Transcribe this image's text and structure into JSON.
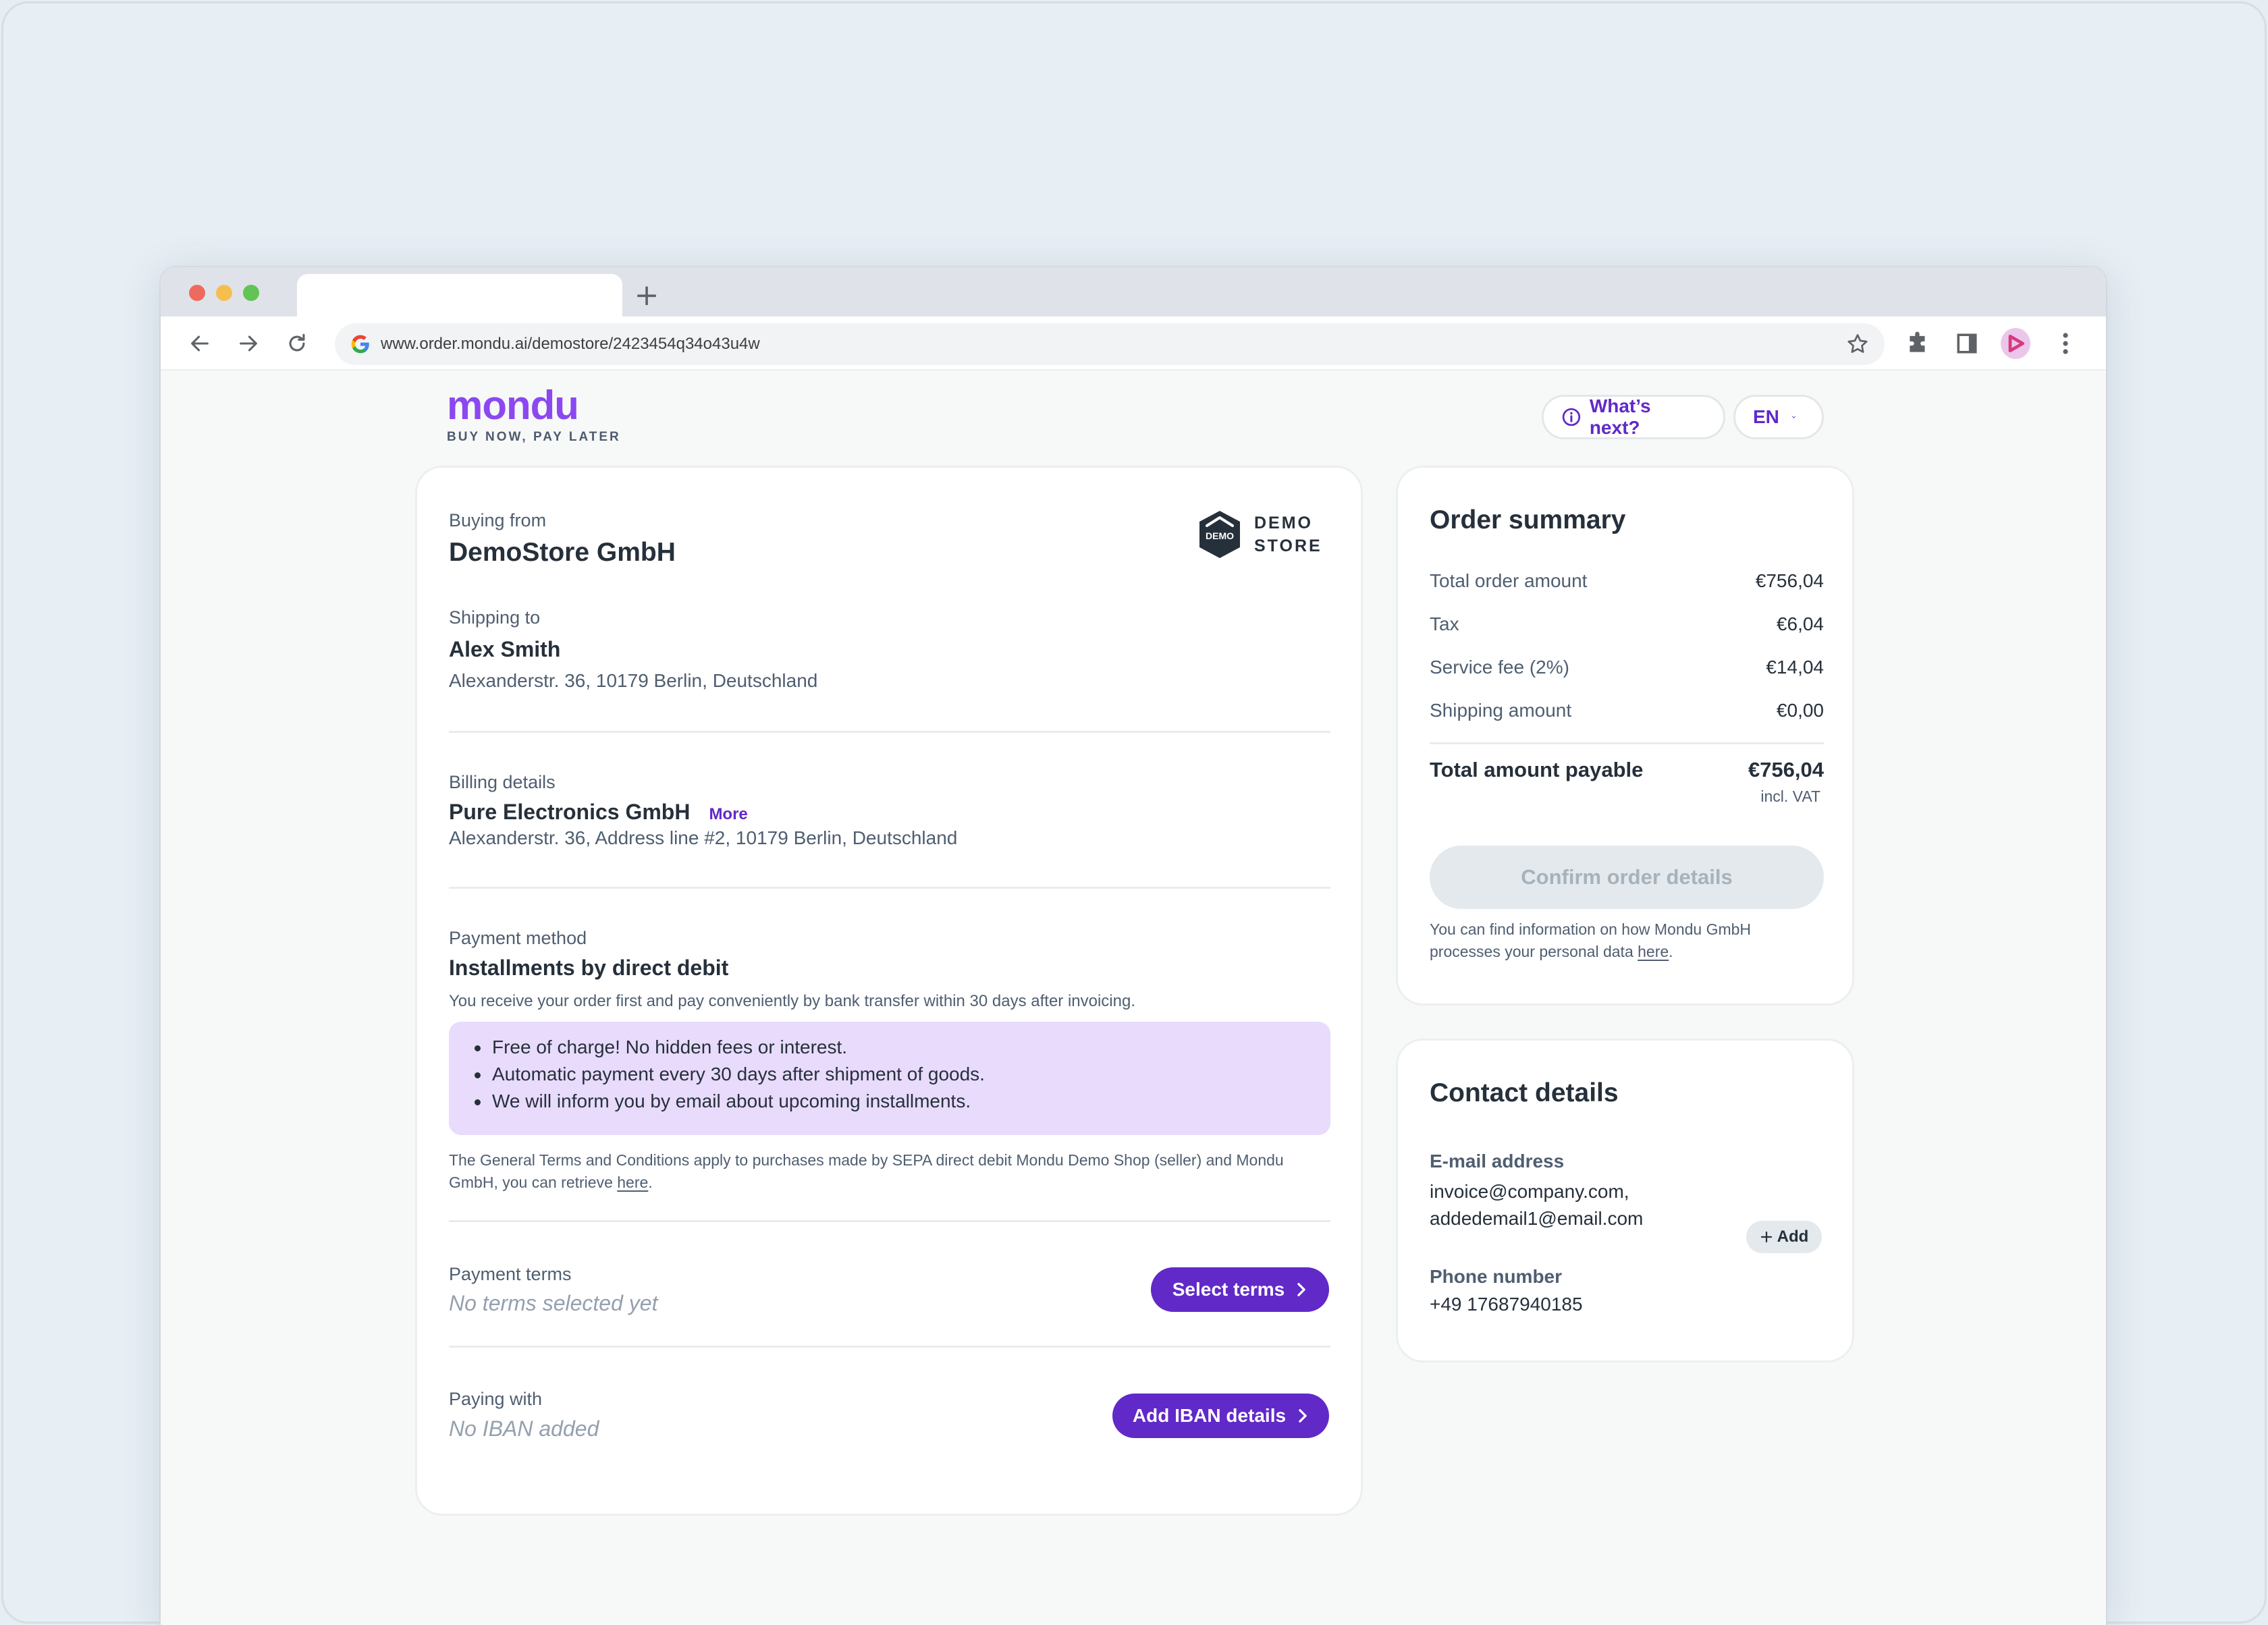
{
  "browser": {
    "url": "www.order.mondu.ai/demostore/2423454q34o43u4w",
    "new_tab_label": "+"
  },
  "header": {
    "logo_text": "mondu",
    "tagline": "BUY NOW, PAY LATER",
    "whats_next_label": "What’s next?",
    "language": "EN"
  },
  "colors": {
    "brand_purple": "#6129c8",
    "logo_purple": "#8b48f0",
    "benefits_bg": "#e8dbfc",
    "disabled_bg": "#e3e9ec"
  },
  "order": {
    "buying_from_label": "Buying from",
    "merchant_name": "DemoStore GmbH",
    "store_logo_badge": "DEMO",
    "store_logo_line1": "DEMO",
    "store_logo_line2": "STORE",
    "shipping_label": "Shipping to",
    "shipping_name": "Alex Smith",
    "shipping_address": "Alexanderstr. 36, 10179 Berlin, Deutschland",
    "billing_label": "Billing details",
    "billing_company": "Pure Electronics GmbH",
    "billing_more": "More",
    "billing_address": "Alexanderstr. 36, Address line #2, 10179 Berlin, Deutschland",
    "payment_method_label": "Payment method",
    "payment_method": "Installments by direct debit",
    "payment_description": "You receive your order first and pay conveniently by bank transfer within 30 days after invoicing.",
    "benefits": [
      "Free of charge! No hidden fees or interest.",
      "Automatic payment every 30 days after shipment of goods.",
      "We will inform you by email about upcoming installments."
    ],
    "terms_text": "The General Terms and Conditions apply to purchases made by SEPA direct debit Mondu Demo Shop (seller) and Mondu GmbH, you can retrieve ",
    "terms_link": "here",
    "terms_end": ".",
    "payment_terms_label": "Payment terms",
    "payment_terms_value": "No terms selected yet",
    "select_terms_button": "Select terms",
    "paying_with_label": "Paying with",
    "paying_with_value": "No IBAN added",
    "add_iban_button": "Add IBAN details"
  },
  "summary": {
    "title": "Order summary",
    "rows": [
      {
        "label": "Total order amount",
        "value": "€756,04"
      },
      {
        "label": "Tax",
        "value": "€6,04"
      },
      {
        "label": "Service fee (2%)",
        "value": "€14,04"
      },
      {
        "label": "Shipping amount",
        "value": "€0,00"
      }
    ],
    "total_label": "Total amount payable",
    "total_value": "€756,04",
    "vat_note": "incl. VAT",
    "confirm_button": "Confirm order details",
    "privacy_text": "You can find information on how Mondu GmbH processes your personal data ",
    "privacy_link": "here",
    "privacy_end": "."
  },
  "contact": {
    "title": "Contact details",
    "email_label": "E-mail address",
    "emails": [
      "invoice@company.com,",
      "addedemail1@email.com"
    ],
    "add_button": "Add",
    "phone_label": "Phone number",
    "phone": "+49 17687940185"
  }
}
